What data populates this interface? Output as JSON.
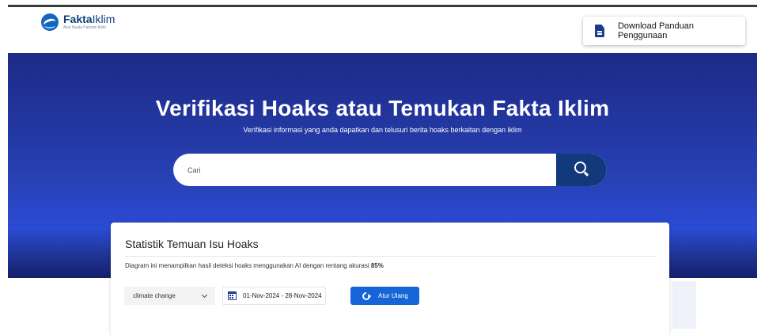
{
  "header": {
    "logo_name_bold": "Fakta",
    "logo_name_light": "Iklim",
    "logo_tagline": "Aksi Nyata Pahami Iklim",
    "download_label": "Download Panduan Penggunaan"
  },
  "hero": {
    "title": "Verifikasi Hoaks atau Temukan Fakta Iklim",
    "subtitle": "Verifikasi informasi yang anda dapatkan dan telusuri berita hoaks berkaitan dengan iklim",
    "search_placeholder": "Cari"
  },
  "stats": {
    "title": "Statistik Temuan Isu Hoaks",
    "description": "Diagram ini menampilkan hasil deteksi hoaks menggunakan AI dengan rentang akurasi ",
    "accuracy": "85%",
    "topic_selected": "climate change",
    "date_range": "01-Nov-2024 - 28-Nov-2024",
    "reset_label": "Atur Ulang"
  },
  "icons": {
    "logo": "faktaiklim-logo-icon",
    "download": "document-icon",
    "search": "search-icon",
    "dropdown": "chevron-down-icon",
    "calendar": "calendar-icon",
    "reset": "refresh-icon"
  },
  "colors": {
    "brand_navy": "#12397c",
    "hero_blue": "#2740b3",
    "button_blue": "#1565d8"
  }
}
